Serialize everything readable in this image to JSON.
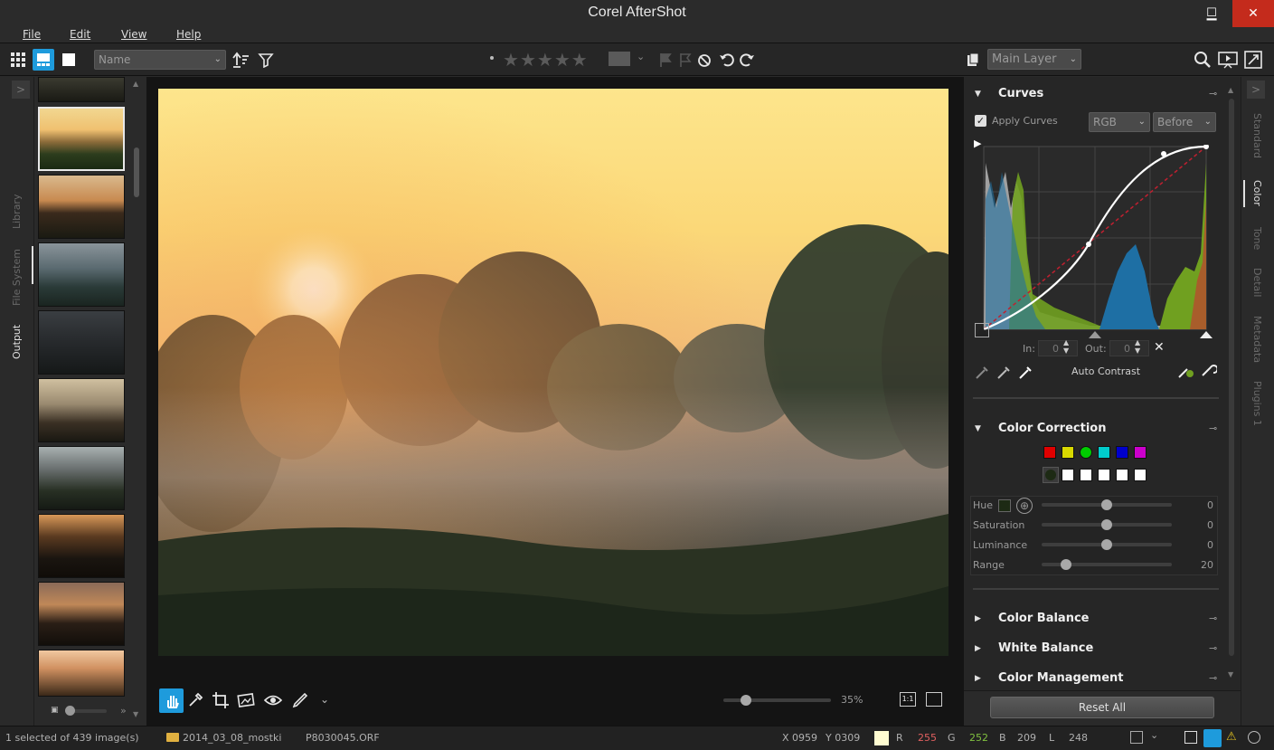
{
  "app": {
    "title": "Corel AfterShot"
  },
  "window_controls": {
    "minimize": "▁",
    "maximize": "☐",
    "close": "✕"
  },
  "menu": {
    "file": "File",
    "edit": "Edit",
    "view": "View",
    "help": "Help"
  },
  "toolbar": {
    "sort_dropdown": "Name",
    "layer_dropdown": "Main Layer",
    "icons": [
      "grid-view-icon",
      "filmstrip-view-icon",
      "single-view-icon",
      "sort-icon",
      "filter-icon",
      "star-icon",
      "color-label-icon",
      "flag-icon",
      "reject-icon",
      "rotate-left-icon",
      "rotate-right-icon",
      "copy-icon",
      "search-icon",
      "slideshow-icon",
      "fullscreen-icon"
    ]
  },
  "left_tabs": {
    "library": "Library",
    "file_system": "File System",
    "output": "Output"
  },
  "right_tabs": {
    "standard": "Standard",
    "color": "Color",
    "tone": "Tone",
    "detail": "Detail",
    "metadata": "Metadata",
    "plugins": "Plugins 1"
  },
  "curves": {
    "title": "Curves",
    "apply_label": "Apply Curves",
    "apply_checked": true,
    "channel": "RGB",
    "mode": "Before",
    "in_label": "In:",
    "in_value": "0",
    "out_label": "Out:",
    "out_value": "0",
    "auto_contrast": "Auto Contrast"
  },
  "color_correction": {
    "title": "Color Correction",
    "swatch_colors": [
      "#e00000",
      "#d8d800",
      "#00cc00",
      "#00cccc",
      "#0000cc",
      "#cc00cc"
    ],
    "hue_label": "Hue",
    "hue_value": "0",
    "saturation_label": "Saturation",
    "saturation_value": "0",
    "luminance_label": "Luminance",
    "luminance_value": "0",
    "range_label": "Range",
    "range_value": "20"
  },
  "sections": {
    "color_balance": "Color Balance",
    "white_balance": "White Balance",
    "color_management": "Color Management"
  },
  "reset_all": "Reset All",
  "viewer": {
    "zoom": "35%",
    "one_to_one": "1:1"
  },
  "status": {
    "selection": "1 selected of 439 image(s)",
    "folder": "2014_03_08_mostki",
    "file": "P8030045.ORF",
    "x": "X 0959",
    "y": "Y 0309",
    "r_label": "R",
    "r_value": "255",
    "g_label": "G",
    "g_value": "252",
    "b_label": "B",
    "b_value": "209",
    "l_label": "L",
    "l_value": "248"
  },
  "colors": {
    "accent": "#1e9bdc",
    "panel": "#262626",
    "swatch_readout": "#fffcd1"
  }
}
